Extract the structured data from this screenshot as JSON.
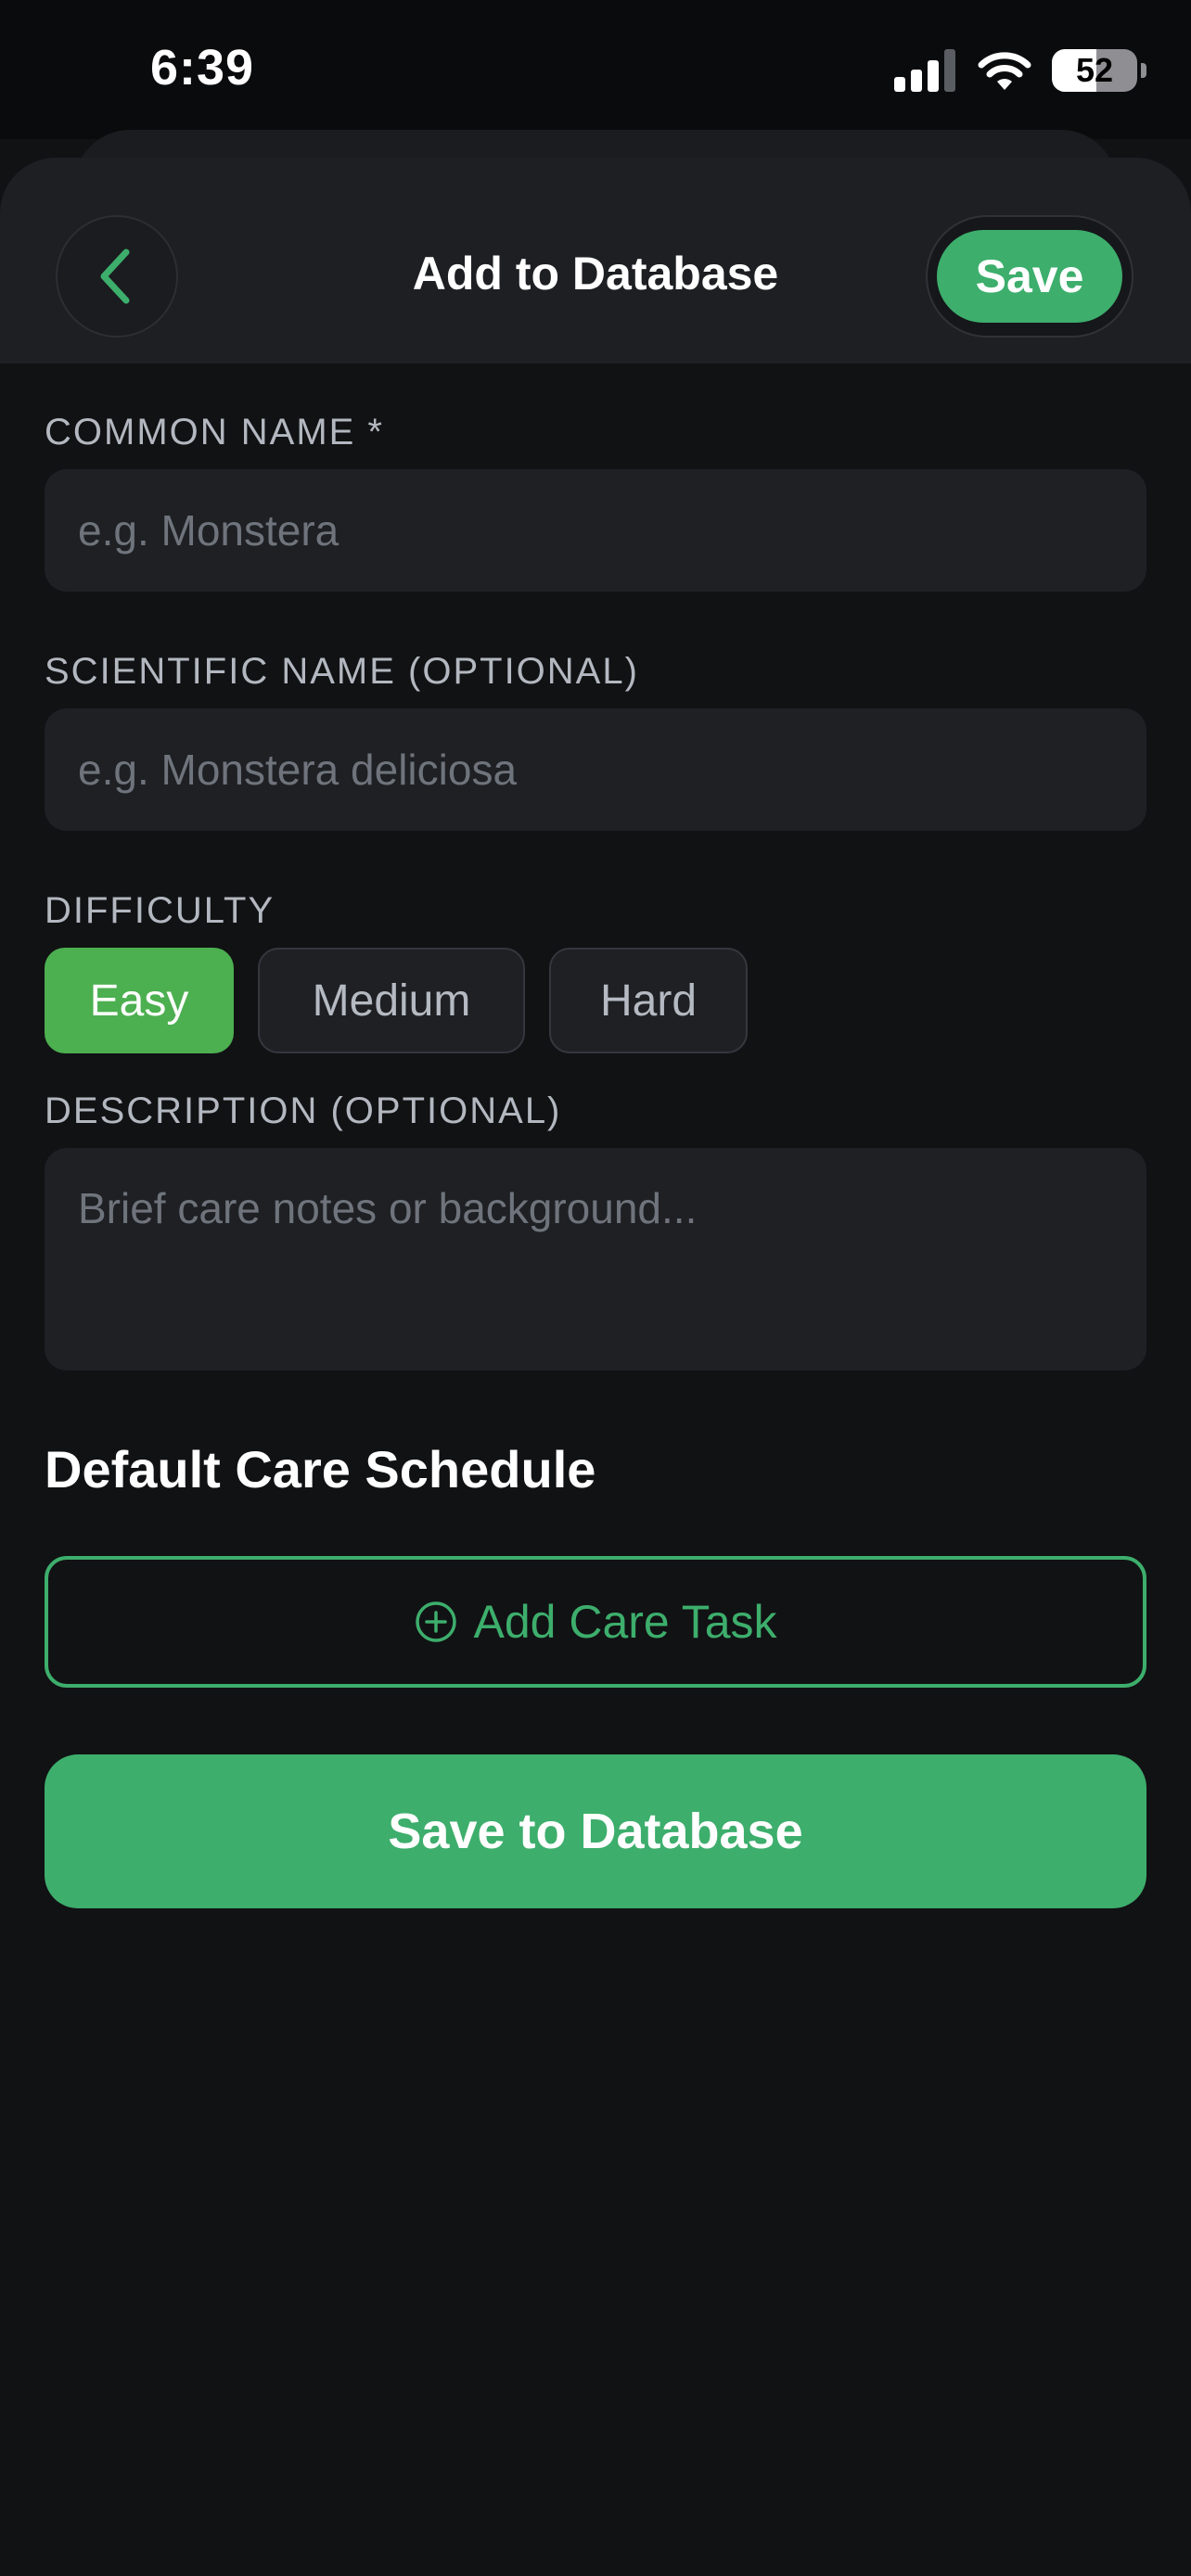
{
  "status_bar": {
    "time": "6:39",
    "battery": "52",
    "icons": [
      "signal-icon",
      "wifi-icon",
      "battery-icon"
    ]
  },
  "header": {
    "title": "Add to Database",
    "back_icon": "chevron-left-icon",
    "save_label": "Save"
  },
  "form": {
    "common_name": {
      "label": "COMMON NAME *",
      "placeholder": "e.g. Monstera",
      "value": ""
    },
    "scientific_name": {
      "label": "SCIENTIFIC NAME (OPTIONAL)",
      "placeholder": "e.g. Monstera deliciosa",
      "value": ""
    },
    "difficulty": {
      "label": "DIFFICULTY",
      "options": [
        "Easy",
        "Medium",
        "Hard"
      ],
      "selected": "Easy"
    },
    "description": {
      "label": "DESCRIPTION (OPTIONAL)",
      "placeholder": "Brief care notes or background...",
      "value": ""
    }
  },
  "care_schedule": {
    "title": "Default Care Schedule",
    "add_task_label": "Add Care Task",
    "add_icon": "plus-circle-icon"
  },
  "actions": {
    "save_to_database_label": "Save to Database"
  },
  "colors": {
    "background": "#111214",
    "header": "#1d1f23",
    "input": "#1e2024",
    "accent": "#3dae6c",
    "selected_chip": "#4caf50",
    "label": "#b3b8c0",
    "placeholder": "#6f747c"
  }
}
